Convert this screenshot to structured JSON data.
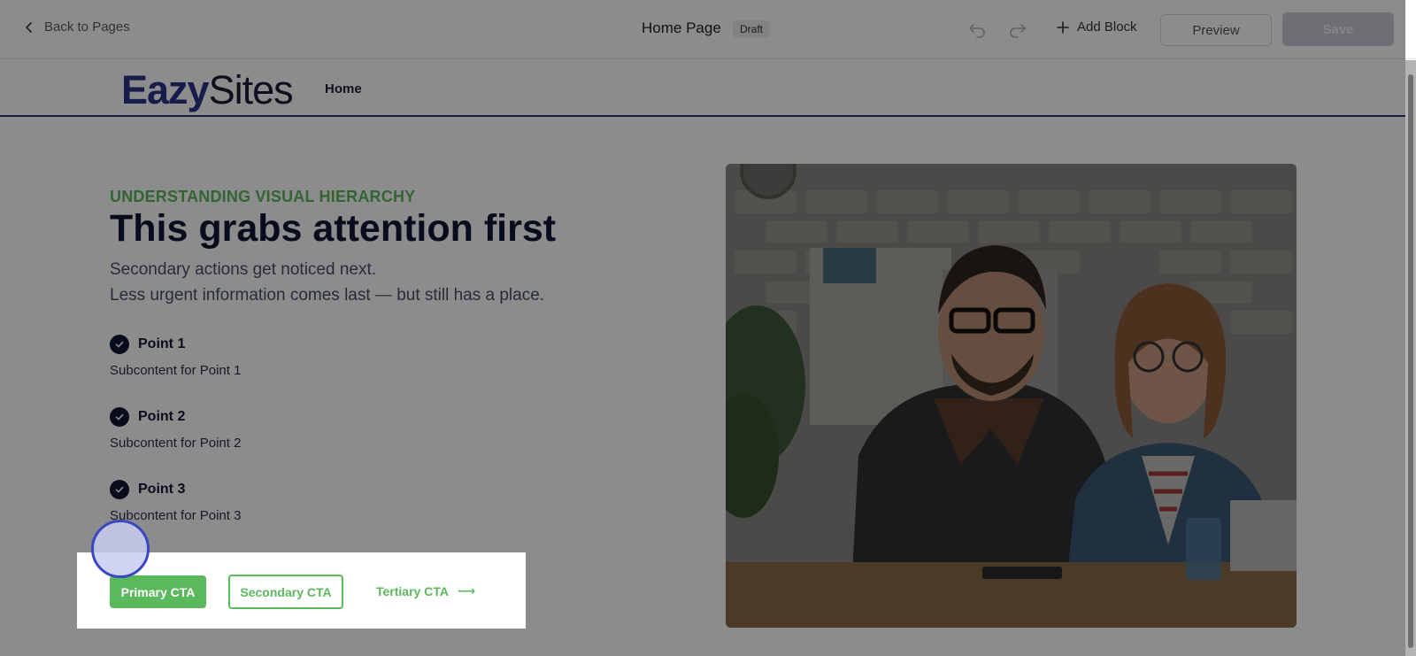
{
  "topbar": {
    "back_label": "Back to Pages",
    "page_title": "Home Page",
    "status_badge": "Draft",
    "add_block_label": "Add Block",
    "preview_label": "Preview",
    "save_label": "Save"
  },
  "site": {
    "logo_part1": "Eazy",
    "logo_part2": "Sites",
    "nav": [
      "Home"
    ]
  },
  "hero": {
    "eyebrow": "UNDERSTANDING VISUAL HIERARCHY",
    "headline": "This grabs attention first",
    "subtext_line1": "Secondary actions get noticed next.",
    "subtext_line2": "Less urgent information comes last — but still has a place.",
    "points": [
      {
        "title": "Point 1",
        "subcontent": "Subcontent for Point 1"
      },
      {
        "title": "Point 2",
        "subcontent": "Subcontent for Point 2"
      },
      {
        "title": "Point 3",
        "subcontent": "Subcontent for Point 3"
      }
    ],
    "cta_primary": "Primary CTA",
    "cta_secondary": "Secondary CTA",
    "cta_tertiary": "Tertiary CTA",
    "cta_tertiary_arrow": "⟶"
  },
  "colors": {
    "accent_green": "#5cb85c",
    "brand_navy": "#2d3488",
    "cursor_ring": "#3848c0"
  }
}
